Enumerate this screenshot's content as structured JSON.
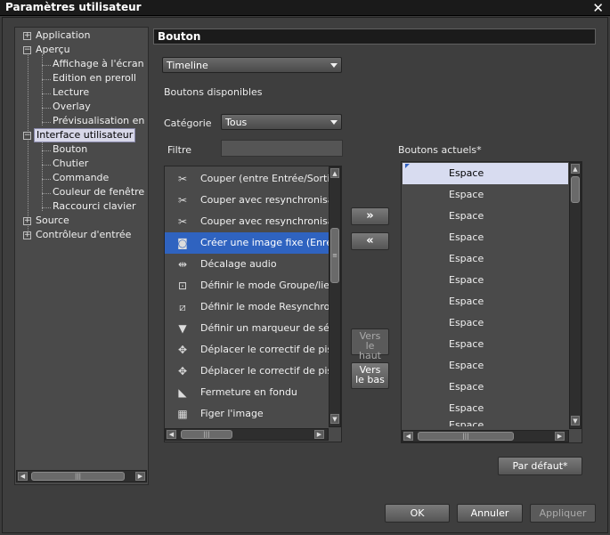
{
  "window": {
    "title": "Paramètres utilisateur",
    "close_glyph": "✕"
  },
  "tree": {
    "items": [
      {
        "label": "Application",
        "expander": "+"
      },
      {
        "label": "Aperçu",
        "expander": "−"
      },
      {
        "label": "Affichage à l'écran"
      },
      {
        "label": "Edition en preroll"
      },
      {
        "label": "Lecture"
      },
      {
        "label": "Overlay"
      },
      {
        "label": "Prévisualisation en mo"
      },
      {
        "label": "Interface utilisateur",
        "expander": "−"
      },
      {
        "label": "Bouton"
      },
      {
        "label": "Chutier"
      },
      {
        "label": "Commande"
      },
      {
        "label": "Couleur de fenêtre"
      },
      {
        "label": "Raccourci clavier"
      },
      {
        "label": "Source",
        "expander": "+"
      },
      {
        "label": "Contrôleur d'entrée",
        "expander": "+"
      }
    ],
    "selected": "Interface utilisateur"
  },
  "panel": {
    "header": "Bouton",
    "timeline_select": "Timeline",
    "available_label": "Boutons disponibles",
    "category_label": "Catégorie",
    "category_select": "Tous",
    "filter_label": "Filtre",
    "filter_value": "",
    "current_label": "Boutons actuels*"
  },
  "available_buttons": [
    {
      "label": "Couper (entre Entrée/Sortie)",
      "icon": "cut-in-out-icon",
      "glyph": "✂"
    },
    {
      "label": "Couper avec resynchronisation",
      "icon": "cut-resync-icon",
      "glyph": "✂"
    },
    {
      "label": "Couper avec resynchronisatio",
      "icon": "cut-resync-icon",
      "glyph": "✂"
    },
    {
      "label": "Créer une image fixe (Enregis",
      "icon": "camera-icon",
      "glyph": "◙",
      "selected": true
    },
    {
      "label": "Décalage audio",
      "icon": "audio-offset-icon",
      "glyph": "⇹"
    },
    {
      "label": "Définir le mode Groupe/lien",
      "icon": "group-link-icon",
      "glyph": "⊡"
    },
    {
      "label": "Définir le mode Resynchronisa",
      "icon": "resync-mode-icon",
      "glyph": "⧄"
    },
    {
      "label": "Définir un marqueur de séque",
      "icon": "sequence-marker-icon",
      "glyph": "▼"
    },
    {
      "label": "Déplacer le correctif de pistes",
      "icon": "move-track-patch-icon",
      "glyph": "✥"
    },
    {
      "label": "Déplacer le correctif de pistes",
      "icon": "move-track-patch-icon",
      "glyph": "✥"
    },
    {
      "label": "Fermeture en fondu",
      "icon": "fade-out-icon",
      "glyph": "◣"
    },
    {
      "label": "Figer l'image",
      "icon": "freeze-frame-icon",
      "glyph": "▦"
    }
  ],
  "current_buttons": [
    "Espace",
    "Espace",
    "Espace",
    "Espace",
    "Espace",
    "Espace",
    "Espace",
    "Espace",
    "Espace",
    "Espace",
    "Espace",
    "Espace",
    "Espace",
    "Espace"
  ],
  "transfer": {
    "add": "»",
    "remove": "«",
    "move_up": "Vers le haut",
    "move_down": "Vers le bas"
  },
  "scroll_glyphs": {
    "left": "◀",
    "right": "▶",
    "up": "▲",
    "down": "▼",
    "grip_h": "|||",
    "grip_v": "≡"
  },
  "footer": {
    "default": "Par défaut*",
    "ok": "OK",
    "cancel": "Annuler",
    "apply": "Appliquer"
  }
}
